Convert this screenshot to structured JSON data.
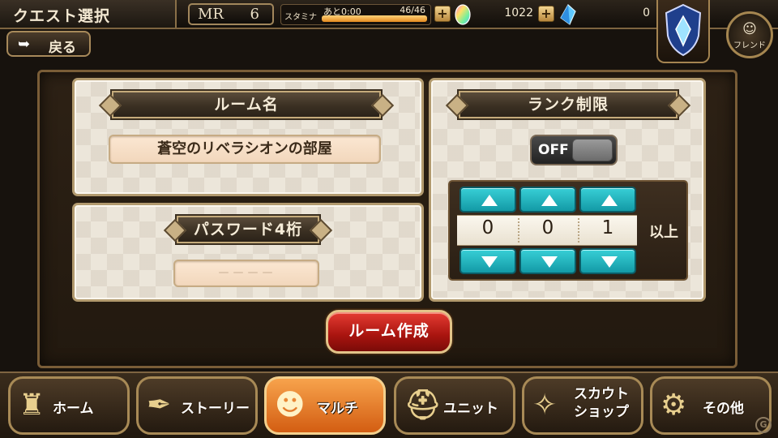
{
  "header": {
    "screen_title": "クエスト選択",
    "rank_label": "MR",
    "rank_value": "6",
    "stamina": {
      "label": "スタミナ",
      "recovery_time": "あと0:00",
      "count": "46/46",
      "fill_fraction": 1.0
    },
    "coins": "1022",
    "crystals": "0",
    "friend_label": "フレンド"
  },
  "back_button": {
    "label": "戻る"
  },
  "room_name": {
    "title": "ルーム名",
    "value": "蒼空のリベラシオンの部屋"
  },
  "password": {
    "title": "パスワード4桁",
    "value": "－－－－"
  },
  "rank_limit": {
    "title": "ランク制限",
    "toggle_label": "OFF",
    "digits": [
      "0",
      "0",
      "1"
    ],
    "suffix": "以上"
  },
  "create_button": {
    "label": "ルーム作成"
  },
  "nav": [
    {
      "label": "ホーム",
      "icon": "castle-icon",
      "active": false
    },
    {
      "label": "ストーリー",
      "icon": "quill-scroll-icon",
      "active": false
    },
    {
      "label": "マルチ",
      "icon": "party-icon",
      "active": true
    },
    {
      "label": "ユニット",
      "icon": "helmet-icon",
      "active": false
    },
    {
      "label": "スカウト",
      "label2": "ショップ",
      "icon": "fairy-icon",
      "active": false
    },
    {
      "label": "その他",
      "icon": "gears-icon",
      "active": false
    }
  ],
  "colors": {
    "accent_teal": "#139aa6",
    "create_red": "#a8140f",
    "active_nav": "#d35d12",
    "frame_gold": "#a88a56"
  }
}
